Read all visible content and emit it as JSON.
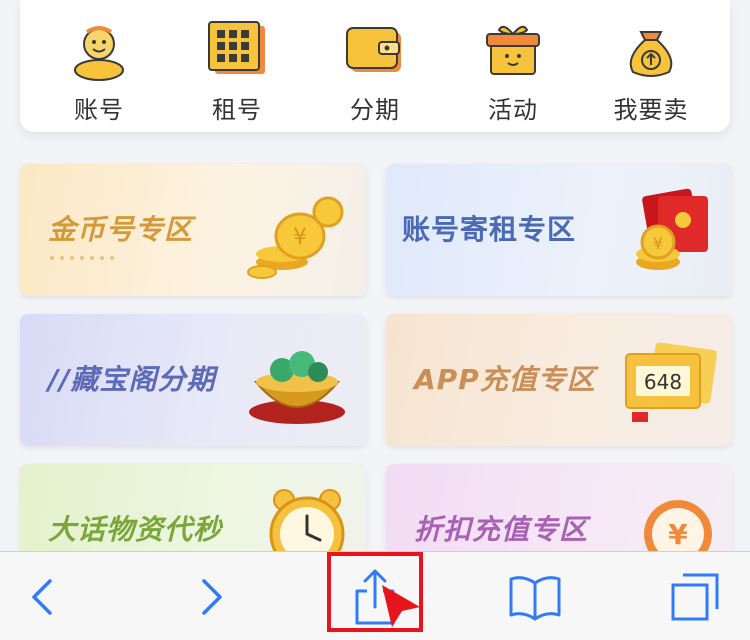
{
  "nav": {
    "items": [
      {
        "label": "账号",
        "icon": "account-avatar-icon"
      },
      {
        "label": "租号",
        "icon": "rent-grid-icon"
      },
      {
        "label": "分期",
        "icon": "wallet-icon"
      },
      {
        "label": "活动",
        "icon": "gift-box-icon"
      },
      {
        "label": "我要卖",
        "icon": "money-bag-icon"
      }
    ]
  },
  "tiles": [
    {
      "title": "金币号专区",
      "icon": "gold-coins-icon",
      "title_color": "#d49a3a"
    },
    {
      "title": "账号寄租专区",
      "icon": "red-envelope-coins-icon",
      "title_color": "#4a6ab6"
    },
    {
      "title": "//藏宝阁分期",
      "icon": "treasure-bowl-icon",
      "title_color": "#5d6ab8"
    },
    {
      "title": "APP充值专区",
      "icon": "ticket-648-icon",
      "title_color": "#c98f57",
      "ticket_value": "648"
    },
    {
      "title": "大话物资代秒",
      "icon": "alarm-clock-icon",
      "title_color": "#7aa63a"
    },
    {
      "title": "折扣充值专区",
      "icon": "yuan-coin-icon",
      "title_color": "#a861b3"
    }
  ],
  "toolbar": {
    "items": [
      {
        "name": "back-button",
        "icon": "chevron-left-icon"
      },
      {
        "name": "forward-button",
        "icon": "chevron-right-icon"
      },
      {
        "name": "share-button",
        "icon": "share-icon"
      },
      {
        "name": "bookmarks-button",
        "icon": "book-icon"
      },
      {
        "name": "tabs-button",
        "icon": "tabs-icon"
      }
    ],
    "accent": "#2f7cf6",
    "highlight_color": "#e8141b"
  }
}
